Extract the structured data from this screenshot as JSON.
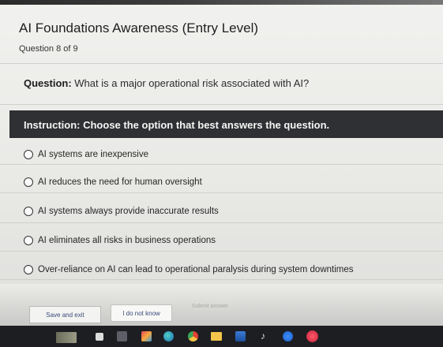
{
  "quiz": {
    "title": "AI Foundations Awareness (Entry Level)",
    "question_count": "Question 8 of 9"
  },
  "question": {
    "label": "Question:",
    "text": " What is a major operational risk associated with AI?"
  },
  "instruction": "Instruction: Choose the option that best answers the question.",
  "options": [
    "AI systems are inexpensive",
    "AI reduces the need for human oversight",
    "AI systems always provide inaccurate results",
    "AI eliminates all risks in business operations",
    "Over-reliance on AI can lead to operational paralysis during system downtimes"
  ],
  "buttons": {
    "save_exit": "Save and exit",
    "dont_know": "I do not know",
    "submit": "Submit answer"
  },
  "taskbar": {
    "icons": [
      "wallpaper-thumbnail-icon",
      "task-view-icon",
      "snipping-tool-icon",
      "games-icon",
      "edge-browser-icon",
      "chrome-browser-icon",
      "file-explorer-icon",
      "store-icon",
      "tiktok-icon",
      "messenger-icon",
      "app-icon"
    ]
  }
}
